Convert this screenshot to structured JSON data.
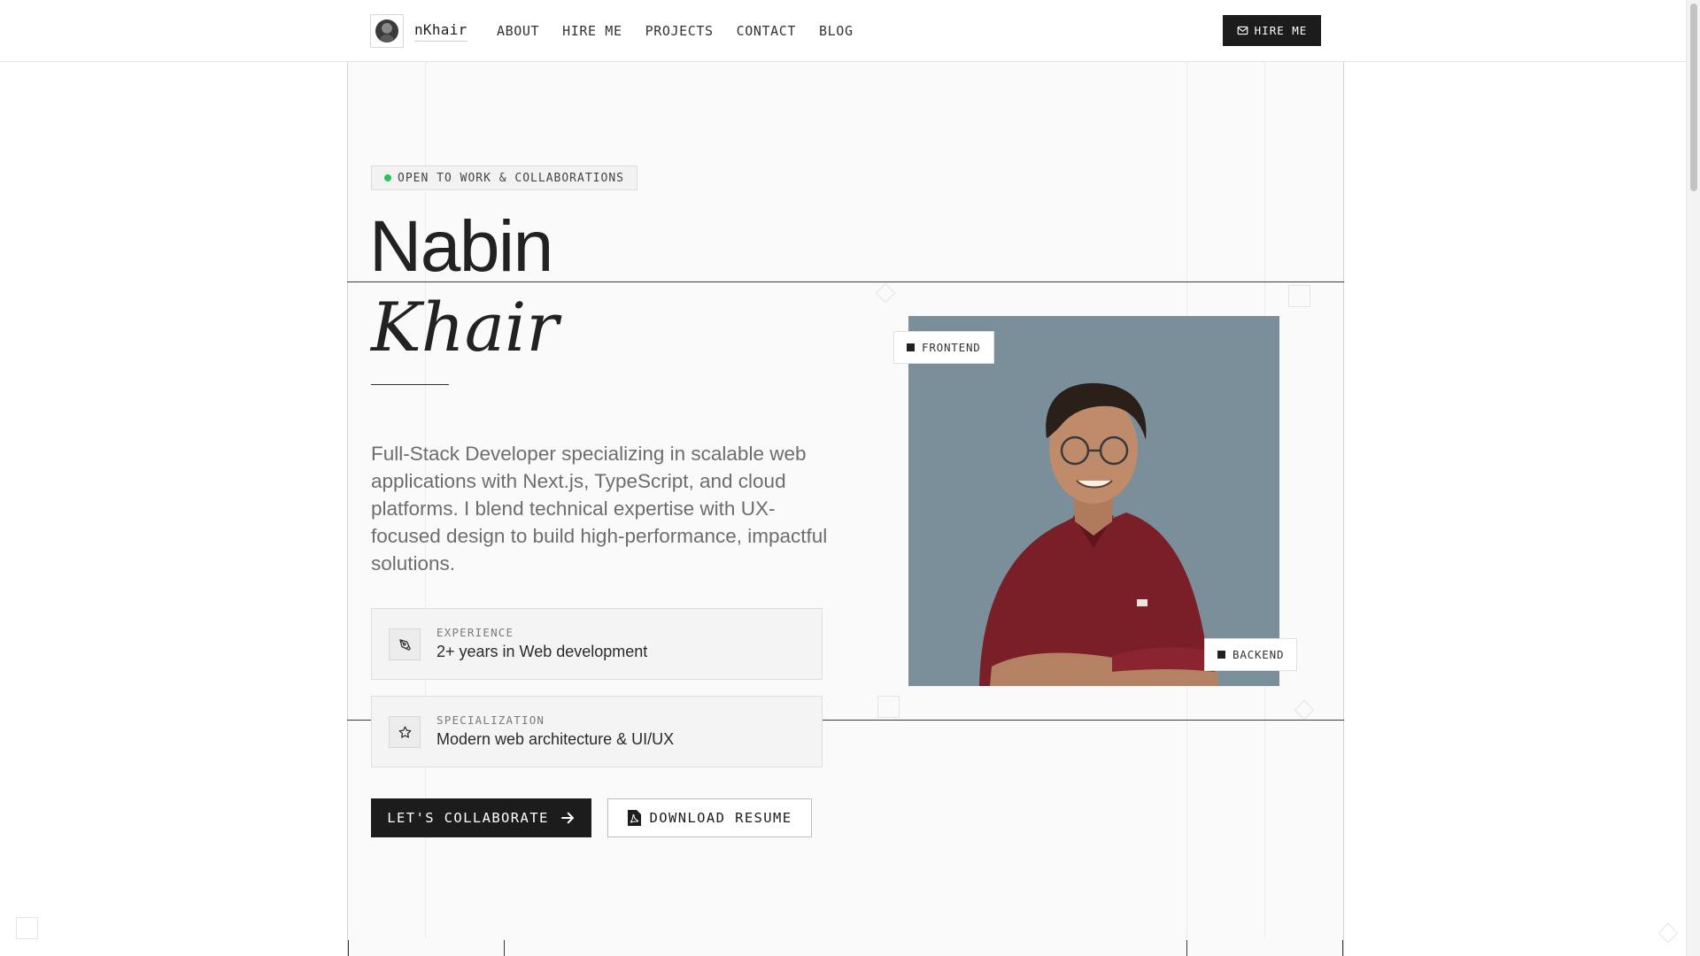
{
  "header": {
    "brand": "nKhair",
    "nav": [
      "ABOUT",
      "HIRE ME",
      "PROJECTS",
      "CONTACT",
      "BLOG"
    ],
    "hire_button": "HIRE ME"
  },
  "hero": {
    "status_badge": "OPEN TO WORK & COLLABORATIONS",
    "first_name": "Nabin",
    "last_name": "Khair",
    "bio": "Full-Stack Developer specializing in scalable web applications with Next.js, TypeScript, and cloud platforms. I blend technical expertise with UX-focused design to build high-performance, impactful solutions.",
    "cards": [
      {
        "label": "EXPERIENCE",
        "value": "2+ years in Web development",
        "icon": "pen-tool-icon"
      },
      {
        "label": "SPECIALIZATION",
        "value": "Modern web architecture & UI/UX",
        "icon": "star-icon"
      }
    ],
    "primary_button": "LET'S COLLABORATE",
    "secondary_button": "DOWNLOAD RESUME",
    "photo_tags": {
      "top": "FRONTEND",
      "bottom": "BACKEND"
    }
  },
  "colors": {
    "accent": "#1c1c1c",
    "status_dot": "#22c55e",
    "photo_background": "#7b8f9a"
  }
}
